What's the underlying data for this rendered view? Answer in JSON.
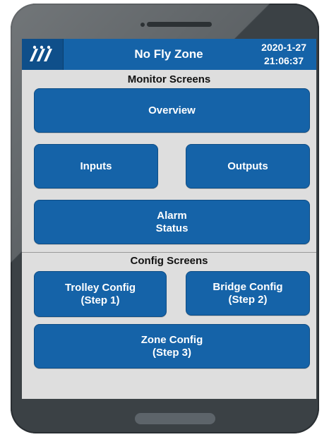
{
  "header": {
    "title": "No Fly Zone",
    "date": "2020-1-27",
    "time": "21:06:37",
    "logo_icon": "brand-logo-icon"
  },
  "monitor": {
    "section_title": "Monitor Screens",
    "overview": "Overview",
    "inputs": "Inputs",
    "outputs": "Outputs",
    "alarm_status": "Alarm\nStatus"
  },
  "config": {
    "section_title": "Config Screens",
    "trolley": "Trolley Config\n(Step 1)",
    "bridge": "Bridge Config\n(Step 2)",
    "zone": "Zone Config\n(Step 3)"
  },
  "colors": {
    "accent": "#1563a8",
    "screen_bg": "#dedede",
    "device": "#3b4145"
  }
}
